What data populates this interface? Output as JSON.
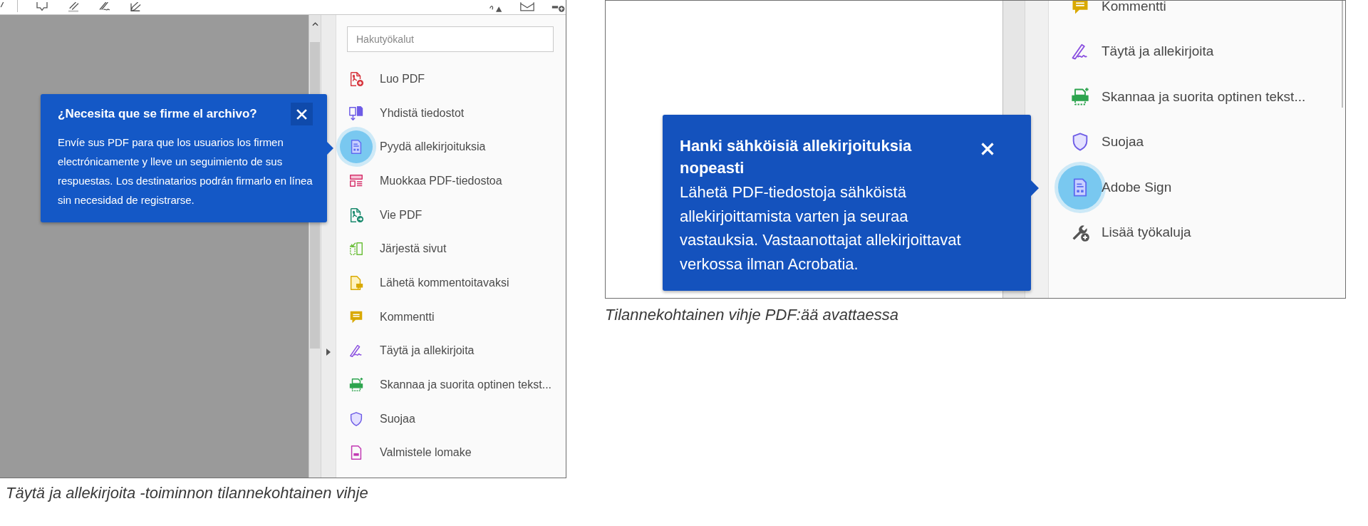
{
  "left_figure": {
    "search": {
      "placeholder": "Hakutyökalut"
    },
    "tools": [
      {
        "label": "Luo PDF",
        "kind": "create",
        "highlighted": false
      },
      {
        "label": "Yhdistä tiedostot",
        "kind": "combine",
        "highlighted": false
      },
      {
        "label": "Pyydä allekirjoituksia",
        "kind": "sign-request",
        "highlighted": true
      },
      {
        "label": "Muokkaa PDF-tiedostoa",
        "kind": "edit",
        "highlighted": false
      },
      {
        "label": "Vie PDF",
        "kind": "export",
        "highlighted": false
      },
      {
        "label": "Järjestä sivut",
        "kind": "organize",
        "highlighted": false
      },
      {
        "label": "Lähetä kommentoitavaksi",
        "kind": "send-comment",
        "highlighted": false
      },
      {
        "label": "Kommentti",
        "kind": "comment",
        "highlighted": false
      },
      {
        "label": "Täytä ja allekirjoita",
        "kind": "fill-sign",
        "highlighted": false
      },
      {
        "label": "Skannaa ja suorita optinen tekst...",
        "kind": "scan",
        "highlighted": false
      },
      {
        "label": "Suojaa",
        "kind": "protect",
        "highlighted": false
      },
      {
        "label": "Valmistele lomake",
        "kind": "form",
        "highlighted": false
      }
    ],
    "tooltip": {
      "title": "¿Necesita que se firme el archivo?",
      "body": "Envíe sus PDF para que los usuarios los firmen electrónicamente y lleve un seguimiento de sus respuestas. Los destinatarios podrán firmarlo en línea sin necesidad de registrarse."
    },
    "caption": "Täytä ja allekirjoita -toiminnon tilannekohtainen vihje"
  },
  "right_figure": {
    "tools": [
      {
        "label": "Kommentti",
        "kind": "comment",
        "highlighted": false
      },
      {
        "label": "Täytä ja allekirjoita",
        "kind": "fill-sign",
        "highlighted": false
      },
      {
        "label": "Skannaa ja suorita optinen tekst...",
        "kind": "scan",
        "highlighted": false
      },
      {
        "label": "Suojaa",
        "kind": "protect",
        "highlighted": false
      },
      {
        "label": "Adobe Sign",
        "kind": "sign-request",
        "highlighted": true
      },
      {
        "label": "Lisää työkaluja",
        "kind": "more",
        "highlighted": false
      }
    ],
    "tooltip": {
      "title": "Hanki sähköisiä allekirjoituksia nopeasti",
      "body": "Lähetä PDF-tiedostoja sähköistä allekirjoittamista varten ja seuraa vastauksia. Vastaanottajat allekirjoittavat verkossa ilman Acrobatia."
    },
    "caption": "Tilannekohtainen vihje PDF:ää avattaessa"
  }
}
